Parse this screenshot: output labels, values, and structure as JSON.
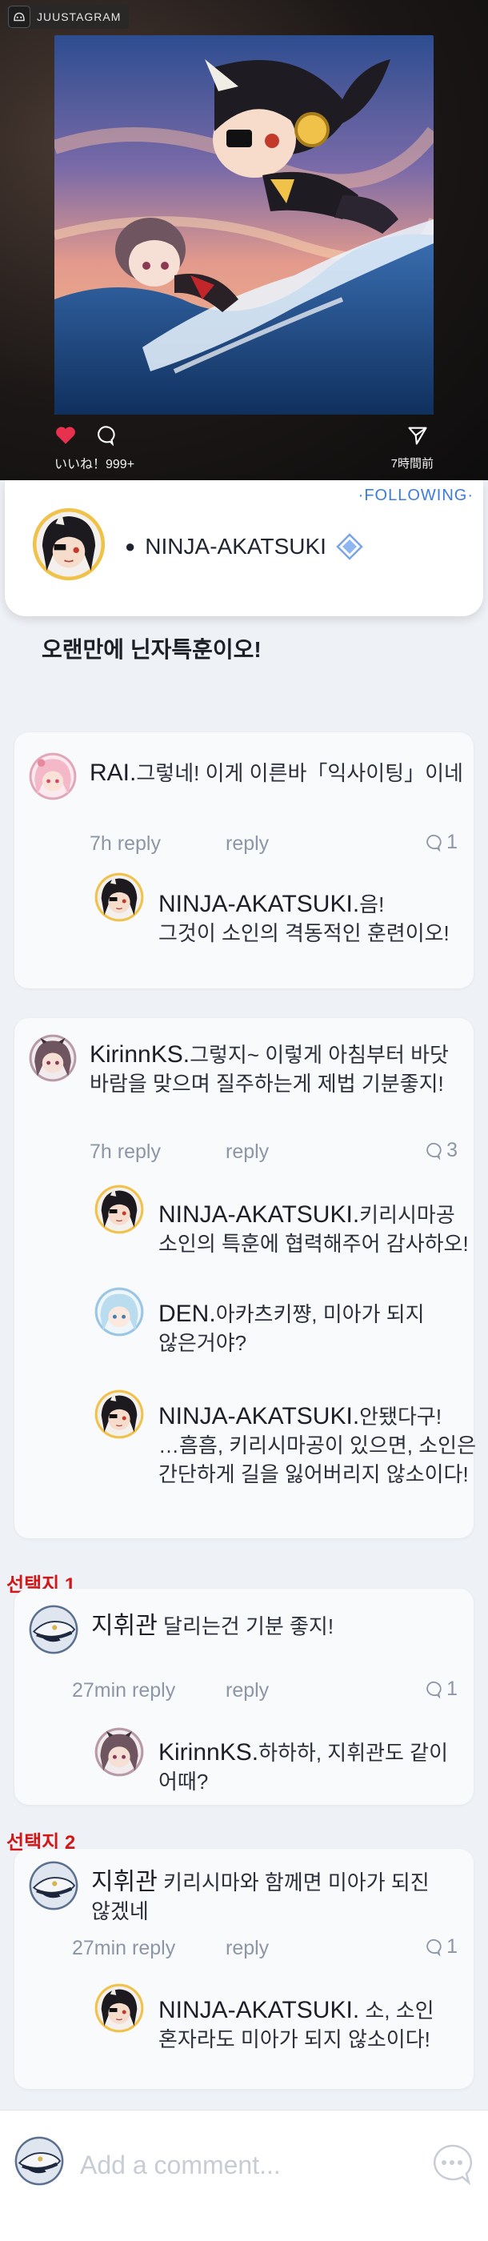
{
  "app": {
    "name": "JUUSTAGRAM"
  },
  "post": {
    "likes": "いいね！999+",
    "time": "7時間前",
    "caption": "오랜만에 닌자특훈이오!"
  },
  "profile": {
    "following": "·FOLLOWING·",
    "name": "NINJA-AKATSUKI"
  },
  "threads": [
    {
      "author": "RAI.",
      "text": "그렇네! 이게 이른바「익사이팅」이네",
      "time_reply": "7h reply",
      "reply_label": "reply",
      "count": "1",
      "replies": [
        {
          "author": "NINJA-AKATSUKI.",
          "line1": "음!",
          "line2": "그것이 소인의 격동적인 훈련이오!"
        }
      ]
    },
    {
      "author": "KirinnKS.",
      "line1": "그렇지~ 이렇게 아침부터 바닷",
      "line2": "바람을 맞으며 질주하는게 제법 기분좋지!",
      "time_reply": "7h reply",
      "reply_label": "reply",
      "count": "3",
      "replies": [
        {
          "author": "NINJA-AKATSUKI.",
          "line1": "키리시마공",
          "line2": "소인의 특훈에 협력해주어 감사하오!"
        },
        {
          "author": "DEN.",
          "line1": "아카츠키쨩, 미아가 되지",
          "line2": "않은거야?"
        },
        {
          "author": "NINJA-AKATSUKI.",
          "line1": "안됐다구!",
          "line2": "…흠흠, 키리시마공이 있으면, 소인은",
          "line3": "간단하게 길을 잃어버리지 않소이다!"
        }
      ]
    },
    {
      "choice": "선택지 1",
      "author": "지휘관",
      "text": "달리는건 기분 좋지!",
      "time_reply": "27min reply",
      "reply_label": "reply",
      "count": "1",
      "replies": [
        {
          "author": "KirinnKS.",
          "line1": "하하하, 지휘관도 같이",
          "line2": "어때?"
        }
      ]
    },
    {
      "choice": "선택지 2",
      "author": "지휘관",
      "line1": "키리시마와 함께면 미아가 되진",
      "line2": "않겠네",
      "time_reply": "27min reply",
      "reply_label": "reply",
      "count": "1",
      "replies": [
        {
          "author": "NINJA-AKATSUKI.",
          "line1": "소, 소인",
          "line2": "혼자라도 미아가 되지 않소이다!"
        }
      ]
    }
  ],
  "composer": {
    "placeholder": "Add a comment..."
  },
  "icons": {
    "like": "heart-icon",
    "comment": "comment-bubble-icon",
    "share": "send-icon",
    "verified": "verified-diamond-icon",
    "reply_count": "chat-bubble-icon",
    "emoji": "chat-dots-icon"
  },
  "colors": {
    "accent": "#3c7be0",
    "like": "#e8314f",
    "choice": "#d11818"
  }
}
